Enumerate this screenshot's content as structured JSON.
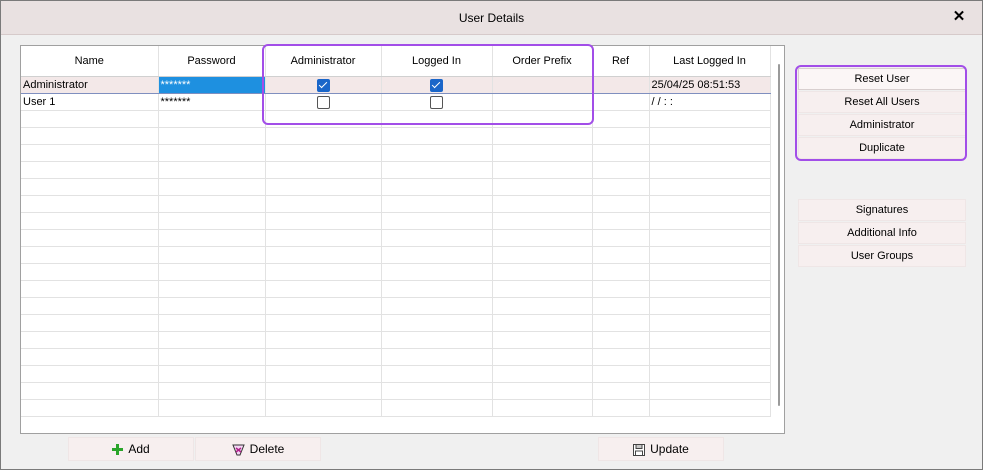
{
  "window": {
    "title": "User Details",
    "close_symbol": "✕"
  },
  "grid": {
    "columns": [
      "Name",
      "Password",
      "Administrator",
      "Logged In",
      "Order Prefix",
      "Ref",
      "Last Logged In"
    ],
    "rows": [
      {
        "name": "Administrator",
        "password": "*******",
        "administrator": true,
        "logged_in": true,
        "order_prefix": "",
        "ref": "",
        "last_logged_in": "25/04/25 08:51:53"
      },
      {
        "name": "User 1",
        "password": "*******",
        "administrator": false,
        "logged_in": false,
        "order_prefix": "",
        "ref": "",
        "last_logged_in": "/ /    : :"
      }
    ]
  },
  "side_buttons": {
    "reset_user": "Reset User",
    "reset_all_users": "Reset All Users",
    "administrator": "Administrator",
    "duplicate": "Duplicate",
    "signatures": "Signatures",
    "additional_info": "Additional Info",
    "user_groups": "User Groups"
  },
  "bottom_buttons": {
    "add": "Add",
    "delete": "Delete",
    "update": "Update"
  },
  "colors": {
    "highlight": "#a24ee8",
    "selection": "#1e90e0",
    "checkbox": "#1a66c9"
  }
}
